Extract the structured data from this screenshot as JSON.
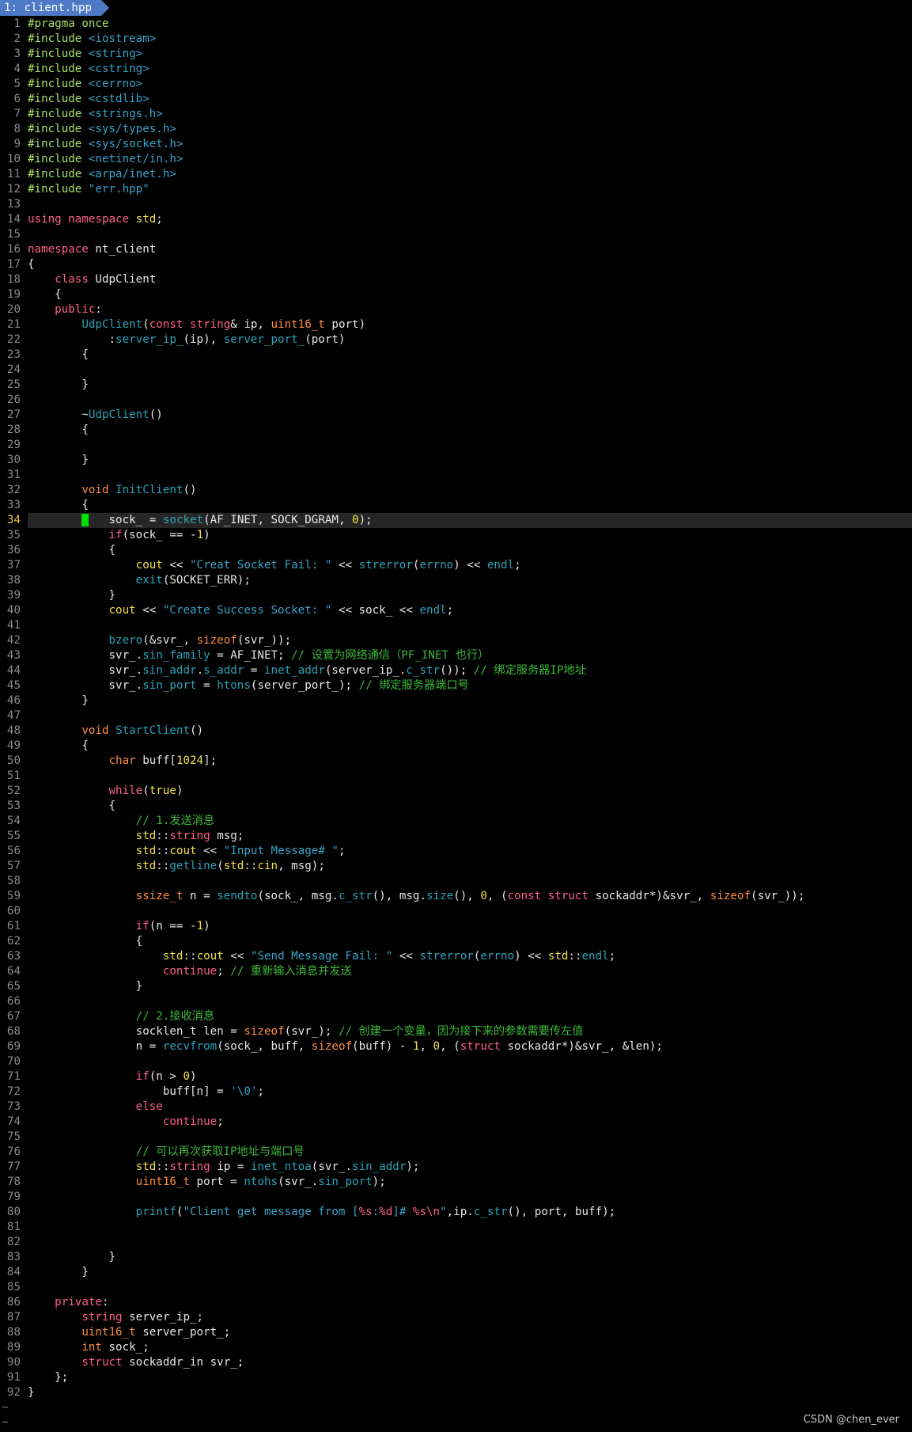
{
  "tabline": {
    "active_tab_label": "1: client.hpp"
  },
  "editor": {
    "cursor_line": 34,
    "lines": [
      [
        [
          "#pragma once",
          "pre"
        ]
      ],
      [
        [
          "#include ",
          "pre"
        ],
        [
          "<iostream>",
          "str"
        ]
      ],
      [
        [
          "#include ",
          "pre"
        ],
        [
          "<string>",
          "str"
        ]
      ],
      [
        [
          "#include ",
          "pre"
        ],
        [
          "<cstring>",
          "str"
        ]
      ],
      [
        [
          "#include ",
          "pre"
        ],
        [
          "<cerrno>",
          "str"
        ]
      ],
      [
        [
          "#include ",
          "pre"
        ],
        [
          "<cstdlib>",
          "str"
        ]
      ],
      [
        [
          "#include ",
          "pre"
        ],
        [
          "<strings.h>",
          "str"
        ]
      ],
      [
        [
          "#include ",
          "pre"
        ],
        [
          "<sys/types.h>",
          "str"
        ]
      ],
      [
        [
          "#include ",
          "pre"
        ],
        [
          "<sys/socket.h>",
          "str"
        ]
      ],
      [
        [
          "#include ",
          "pre"
        ],
        [
          "<netinet/in.h>",
          "str"
        ]
      ],
      [
        [
          "#include ",
          "pre"
        ],
        [
          "<arpa/inet.h>",
          "str"
        ]
      ],
      [
        [
          "#include ",
          "pre"
        ],
        [
          "\"err.hpp\"",
          "str"
        ]
      ],
      [],
      [
        [
          "using namespace ",
          "kw"
        ],
        [
          "std",
          "ns"
        ],
        [
          ";",
          "pl"
        ]
      ],
      [],
      [
        [
          "namespace ",
          "kw"
        ],
        [
          "nt_client",
          "pl"
        ]
      ],
      [
        [
          "{",
          "pl"
        ]
      ],
      [
        [
          "    ",
          "pl"
        ],
        [
          "class ",
          "kw"
        ],
        [
          "UdpClient",
          "pl"
        ]
      ],
      [
        [
          "    {",
          "pl"
        ]
      ],
      [
        [
          "    ",
          "pl"
        ],
        [
          "public",
          "kw"
        ],
        [
          ":",
          "pl"
        ]
      ],
      [
        [
          "        ",
          "pl"
        ],
        [
          "UdpClient",
          "fn"
        ],
        [
          "(",
          "pl"
        ],
        [
          "const string",
          "kw"
        ],
        [
          "& ip, ",
          "pl"
        ],
        [
          "uint16_t",
          "typ"
        ],
        [
          " port)",
          "pl"
        ]
      ],
      [
        [
          "            :",
          "pl"
        ],
        [
          "server_ip_",
          "fn"
        ],
        [
          "(ip), ",
          "pl"
        ],
        [
          "server_port_",
          "fn"
        ],
        [
          "(port)",
          "pl"
        ]
      ],
      [
        [
          "        {",
          "pl"
        ]
      ],
      [],
      [
        [
          "        }",
          "pl"
        ]
      ],
      [],
      [
        [
          "        ~",
          "pl"
        ],
        [
          "UdpClient",
          "fn"
        ],
        [
          "()",
          "pl"
        ]
      ],
      [
        [
          "        {",
          "pl"
        ]
      ],
      [],
      [
        [
          "        }",
          "pl"
        ]
      ],
      [],
      [
        [
          "        ",
          "pl"
        ],
        [
          "void ",
          "typ"
        ],
        [
          "InitClient",
          "fn"
        ],
        [
          "()",
          "pl"
        ]
      ],
      [
        [
          "        {",
          "pl"
        ]
      ],
      [
        [
          "        ",
          "pl"
        ],
        [
          " ",
          "cur"
        ],
        [
          "   sock_ = ",
          "pl"
        ],
        [
          "socket",
          "fn"
        ],
        [
          "(AF_INET, SOCK_DGRAM, ",
          "pl"
        ],
        [
          "0",
          "num"
        ],
        [
          ");",
          "pl"
        ]
      ],
      [
        [
          "            ",
          "pl"
        ],
        [
          "if",
          "kw"
        ],
        [
          "(sock_ == -",
          "pl"
        ],
        [
          "1",
          "num"
        ],
        [
          ")",
          "pl"
        ]
      ],
      [
        [
          "            {",
          "pl"
        ]
      ],
      [
        [
          "                ",
          "pl"
        ],
        [
          "cout",
          "ns"
        ],
        [
          " << ",
          "pl"
        ],
        [
          "\"Creat Socket Fail: \"",
          "str"
        ],
        [
          " << ",
          "pl"
        ],
        [
          "strerror",
          "fn"
        ],
        [
          "(",
          "pl"
        ],
        [
          "errno",
          "fn"
        ],
        [
          ") << ",
          "pl"
        ],
        [
          "endl",
          "fn"
        ],
        [
          ";",
          "pl"
        ]
      ],
      [
        [
          "                ",
          "pl"
        ],
        [
          "exit",
          "fn"
        ],
        [
          "(SOCKET_ERR);",
          "pl"
        ]
      ],
      [
        [
          "            }",
          "pl"
        ]
      ],
      [
        [
          "            ",
          "pl"
        ],
        [
          "cout",
          "ns"
        ],
        [
          " << ",
          "pl"
        ],
        [
          "\"Create Success Socket: \"",
          "str"
        ],
        [
          " << sock_ << ",
          "pl"
        ],
        [
          "endl",
          "fn"
        ],
        [
          ";",
          "pl"
        ]
      ],
      [],
      [
        [
          "            ",
          "pl"
        ],
        [
          "bzero",
          "fn"
        ],
        [
          "(&svr_, ",
          "pl"
        ],
        [
          "sizeof",
          "typ"
        ],
        [
          "(svr_));",
          "pl"
        ]
      ],
      [
        [
          "            svr_.",
          "pl"
        ],
        [
          "sin_family",
          "fn"
        ],
        [
          " = AF_INET; ",
          "pl"
        ],
        [
          "// 设置为网络通信（PF_INET 也行）",
          "com"
        ]
      ],
      [
        [
          "            svr_.",
          "pl"
        ],
        [
          "sin_addr",
          "fn"
        ],
        [
          ".",
          "pl"
        ],
        [
          "s_addr",
          "fn"
        ],
        [
          " = ",
          "pl"
        ],
        [
          "inet_addr",
          "fn"
        ],
        [
          "(server_ip_.",
          "pl"
        ],
        [
          "c_str",
          "fn"
        ],
        [
          "()); ",
          "pl"
        ],
        [
          "// 绑定服务器IP地址",
          "com"
        ]
      ],
      [
        [
          "            svr_.",
          "pl"
        ],
        [
          "sin_port",
          "fn"
        ],
        [
          " = ",
          "pl"
        ],
        [
          "htons",
          "fn"
        ],
        [
          "(server_port_); ",
          "pl"
        ],
        [
          "// 绑定服务器端口号",
          "com"
        ]
      ],
      [
        [
          "        }",
          "pl"
        ]
      ],
      [],
      [
        [
          "        ",
          "pl"
        ],
        [
          "void ",
          "typ"
        ],
        [
          "StartClient",
          "fn"
        ],
        [
          "()",
          "pl"
        ]
      ],
      [
        [
          "        {",
          "pl"
        ]
      ],
      [
        [
          "            ",
          "pl"
        ],
        [
          "char ",
          "typ"
        ],
        [
          "buff[",
          "pl"
        ],
        [
          "1024",
          "num"
        ],
        [
          "];",
          "pl"
        ]
      ],
      [],
      [
        [
          "            ",
          "pl"
        ],
        [
          "while",
          "kw"
        ],
        [
          "(",
          "pl"
        ],
        [
          "true",
          "num"
        ],
        [
          ")",
          "pl"
        ]
      ],
      [
        [
          "            {",
          "pl"
        ]
      ],
      [
        [
          "                ",
          "pl"
        ],
        [
          "// 1.发送消息",
          "com"
        ]
      ],
      [
        [
          "                ",
          "pl"
        ],
        [
          "std",
          "ns"
        ],
        [
          "::",
          "pl"
        ],
        [
          "string ",
          "kw"
        ],
        [
          "msg;",
          "pl"
        ]
      ],
      [
        [
          "                ",
          "pl"
        ],
        [
          "std",
          "ns"
        ],
        [
          "::",
          "pl"
        ],
        [
          "cout",
          "ns"
        ],
        [
          " << ",
          "pl"
        ],
        [
          "\"Input Message# \"",
          "str"
        ],
        [
          ";",
          "pl"
        ]
      ],
      [
        [
          "                ",
          "pl"
        ],
        [
          "std",
          "ns"
        ],
        [
          "::",
          "pl"
        ],
        [
          "getline",
          "fn"
        ],
        [
          "(",
          "pl"
        ],
        [
          "std",
          "ns"
        ],
        [
          "::",
          "pl"
        ],
        [
          "cin",
          "ns"
        ],
        [
          ", msg);",
          "pl"
        ]
      ],
      [],
      [
        [
          "                ",
          "pl"
        ],
        [
          "ssize_t",
          "typ"
        ],
        [
          " n = ",
          "pl"
        ],
        [
          "sendto",
          "fn"
        ],
        [
          "(sock_, msg.",
          "pl"
        ],
        [
          "c_str",
          "fn"
        ],
        [
          "(), msg.",
          "pl"
        ],
        [
          "size",
          "fn"
        ],
        [
          "(), ",
          "pl"
        ],
        [
          "0",
          "num"
        ],
        [
          ", (",
          "pl"
        ],
        [
          "const struct ",
          "kw"
        ],
        [
          "sockaddr*)&svr_, ",
          "pl"
        ],
        [
          "sizeof",
          "typ"
        ],
        [
          "(svr_));",
          "pl"
        ]
      ],
      [],
      [
        [
          "                ",
          "pl"
        ],
        [
          "if",
          "kw"
        ],
        [
          "(n == -",
          "pl"
        ],
        [
          "1",
          "num"
        ],
        [
          ")",
          "pl"
        ]
      ],
      [
        [
          "                {",
          "pl"
        ]
      ],
      [
        [
          "                    ",
          "pl"
        ],
        [
          "std",
          "ns"
        ],
        [
          "::",
          "pl"
        ],
        [
          "cout",
          "ns"
        ],
        [
          " << ",
          "pl"
        ],
        [
          "\"Send Message Fail: \"",
          "str"
        ],
        [
          " << ",
          "pl"
        ],
        [
          "strerror",
          "fn"
        ],
        [
          "(",
          "pl"
        ],
        [
          "errno",
          "fn"
        ],
        [
          ") << ",
          "pl"
        ],
        [
          "std",
          "ns"
        ],
        [
          "::",
          "pl"
        ],
        [
          "endl",
          "fn"
        ],
        [
          ";",
          "pl"
        ]
      ],
      [
        [
          "                    ",
          "pl"
        ],
        [
          "continue",
          "kw"
        ],
        [
          "; ",
          "pl"
        ],
        [
          "// 重新输入消息并发送",
          "com"
        ]
      ],
      [
        [
          "                }",
          "pl"
        ]
      ],
      [],
      [
        [
          "                ",
          "pl"
        ],
        [
          "// 2.接收消息",
          "com"
        ]
      ],
      [
        [
          "                socklen_t len = ",
          "pl"
        ],
        [
          "sizeof",
          "typ"
        ],
        [
          "(svr_); ",
          "pl"
        ],
        [
          "// 创建一个变量，因为接下来的参数需要传左值",
          "com"
        ]
      ],
      [
        [
          "                n = ",
          "pl"
        ],
        [
          "recvfrom",
          "fn"
        ],
        [
          "(sock_, buff, ",
          "pl"
        ],
        [
          "sizeof",
          "typ"
        ],
        [
          "(buff) - ",
          "pl"
        ],
        [
          "1",
          "num"
        ],
        [
          ", ",
          "pl"
        ],
        [
          "0",
          "num"
        ],
        [
          ", (",
          "pl"
        ],
        [
          "struct ",
          "kw"
        ],
        [
          "sockaddr*)&svr_, &len);",
          "pl"
        ]
      ],
      [],
      [
        [
          "                ",
          "pl"
        ],
        [
          "if",
          "kw"
        ],
        [
          "(n > ",
          "pl"
        ],
        [
          "0",
          "num"
        ],
        [
          ")",
          "pl"
        ]
      ],
      [
        [
          "                    buff[n] = ",
          "pl"
        ],
        [
          "'\\0'",
          "str"
        ],
        [
          ";",
          "pl"
        ]
      ],
      [
        [
          "                ",
          "pl"
        ],
        [
          "else",
          "kw"
        ]
      ],
      [
        [
          "                    ",
          "pl"
        ],
        [
          "continue",
          "kw"
        ],
        [
          ";",
          "pl"
        ]
      ],
      [],
      [
        [
          "                ",
          "pl"
        ],
        [
          "// 可以再次获取IP地址与端口号",
          "com"
        ]
      ],
      [
        [
          "                ",
          "pl"
        ],
        [
          "std",
          "ns"
        ],
        [
          "::",
          "pl"
        ],
        [
          "string ",
          "kw"
        ],
        [
          "ip = ",
          "pl"
        ],
        [
          "inet_ntoa",
          "fn"
        ],
        [
          "(svr_.",
          "pl"
        ],
        [
          "sin_addr",
          "fn"
        ],
        [
          ");",
          "pl"
        ]
      ],
      [
        [
          "                ",
          "pl"
        ],
        [
          "uint16_t",
          "typ"
        ],
        [
          " port = ",
          "pl"
        ],
        [
          "ntohs",
          "fn"
        ],
        [
          "(svr_.",
          "pl"
        ],
        [
          "sin_port",
          "fn"
        ],
        [
          ");",
          "pl"
        ]
      ],
      [],
      [
        [
          "                ",
          "pl"
        ],
        [
          "printf",
          "fn"
        ],
        [
          "(",
          "pl"
        ],
        [
          "\"Client get message from [",
          "str"
        ],
        [
          "%s",
          "kw"
        ],
        [
          ":",
          "str"
        ],
        [
          "%d",
          "kw"
        ],
        [
          "]# ",
          "str"
        ],
        [
          "%s\\n",
          "kw"
        ],
        [
          "\"",
          "str"
        ],
        [
          ",ip.",
          "pl"
        ],
        [
          "c_str",
          "fn"
        ],
        [
          "(), port, buff);",
          "pl"
        ]
      ],
      [],
      [],
      [
        [
          "            }",
          "pl"
        ]
      ],
      [
        [
          "        }",
          "pl"
        ]
      ],
      [],
      [
        [
          "    ",
          "pl"
        ],
        [
          "private",
          "kw"
        ],
        [
          ":",
          "pl"
        ]
      ],
      [
        [
          "        ",
          "pl"
        ],
        [
          "string ",
          "kw"
        ],
        [
          "server_ip_;",
          "pl"
        ]
      ],
      [
        [
          "        ",
          "pl"
        ],
        [
          "uint16_t",
          "typ"
        ],
        [
          " server_port_;",
          "pl"
        ]
      ],
      [
        [
          "        ",
          "pl"
        ],
        [
          "int ",
          "typ"
        ],
        [
          "sock_;",
          "pl"
        ]
      ],
      [
        [
          "        ",
          "pl"
        ],
        [
          "struct ",
          "kw"
        ],
        [
          "sockaddr_in svr_;",
          "pl"
        ]
      ],
      [
        [
          "    };",
          "pl"
        ]
      ],
      [
        [
          "}",
          "pl"
        ]
      ]
    ],
    "empty_line_marker": "~",
    "empty_line_count": 2
  },
  "watermark": "CSDN @chen_ever",
  "colors": {
    "background": "#000000",
    "tab_active": "#4e79c4",
    "cursor": "#00e000",
    "cursorline": "#262626",
    "line_number": "#8a8a8a",
    "preprocessor": "#a8e06a",
    "string": "#3aa3c8",
    "keyword": "#ff5f87",
    "type": "#ff8c42",
    "function": "#2ba3b8",
    "number": "#f0e14a",
    "comment": "#3cb83c"
  }
}
